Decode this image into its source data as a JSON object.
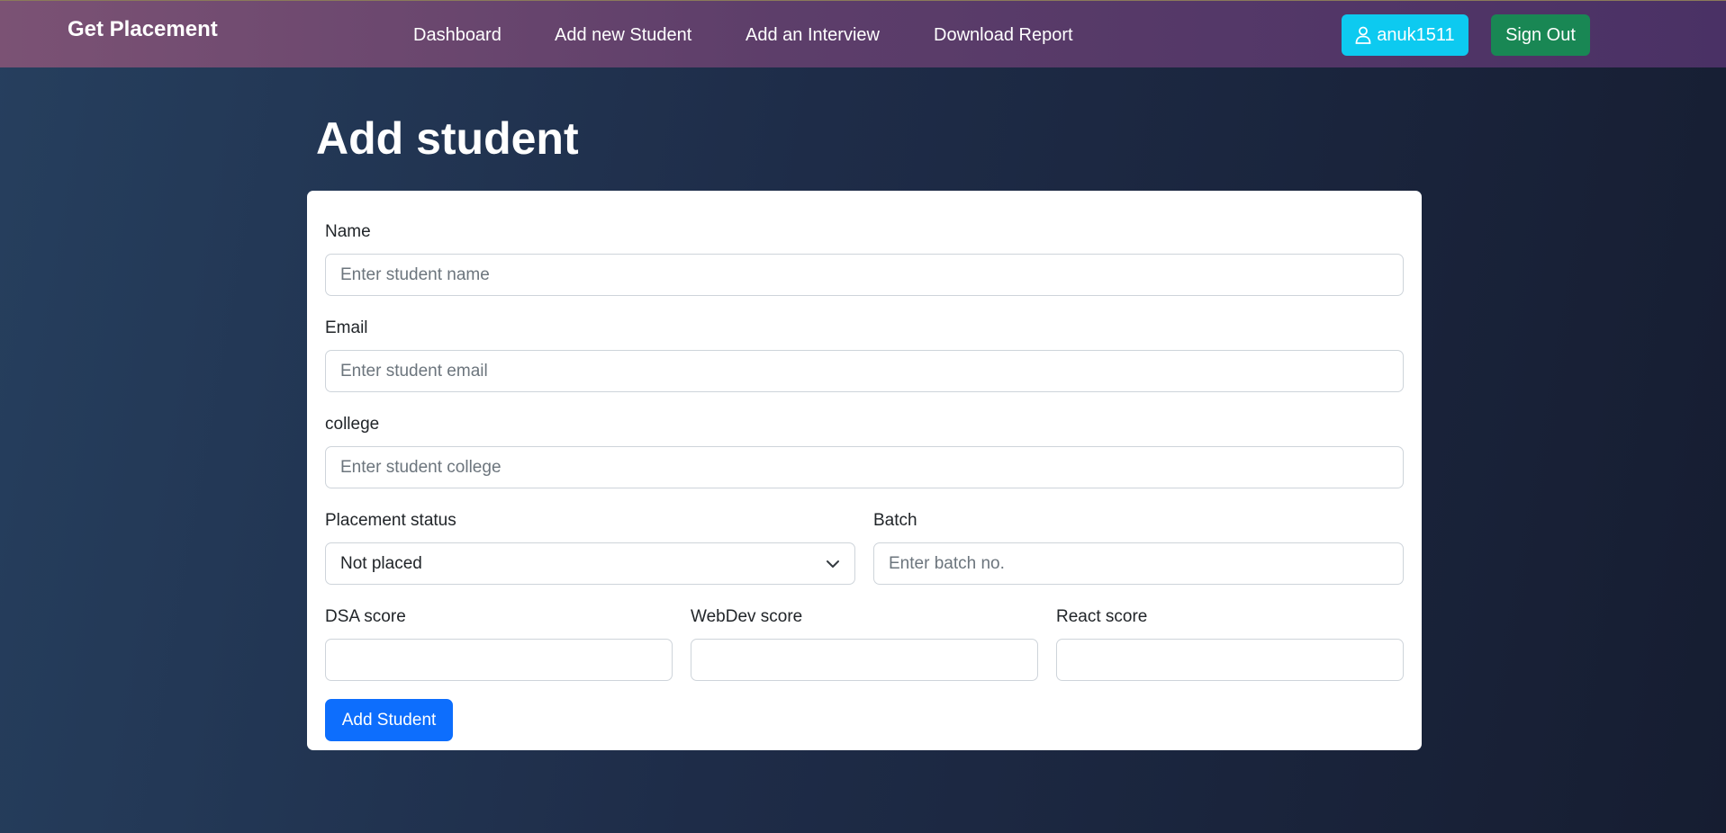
{
  "navbar": {
    "brand": "Get Placement",
    "links": [
      "Dashboard",
      "Add new Student",
      "Add an Interview",
      "Download Report"
    ],
    "user_label": "anuk1511",
    "user_icon": "person-icon",
    "signout_label": "Sign Out"
  },
  "page": {
    "title": "Add student"
  },
  "form": {
    "name": {
      "label": "Name",
      "placeholder": "Enter student name",
      "value": ""
    },
    "email": {
      "label": "Email",
      "placeholder": "Enter student email",
      "value": ""
    },
    "college": {
      "label": "college",
      "placeholder": "Enter student college",
      "value": ""
    },
    "placement_status": {
      "label": "Placement status",
      "selected": "Not placed"
    },
    "batch": {
      "label": "Batch",
      "placeholder": "Enter batch no.",
      "value": ""
    },
    "dsa": {
      "label": "DSA score",
      "value": ""
    },
    "webdev": {
      "label": "WebDev score",
      "value": ""
    },
    "react": {
      "label": "React score",
      "value": ""
    },
    "submit_label": "Add Student"
  },
  "colors": {
    "user_button": "#0dcaf0",
    "signout_button": "#198754",
    "primary_button": "#0d6efd"
  }
}
